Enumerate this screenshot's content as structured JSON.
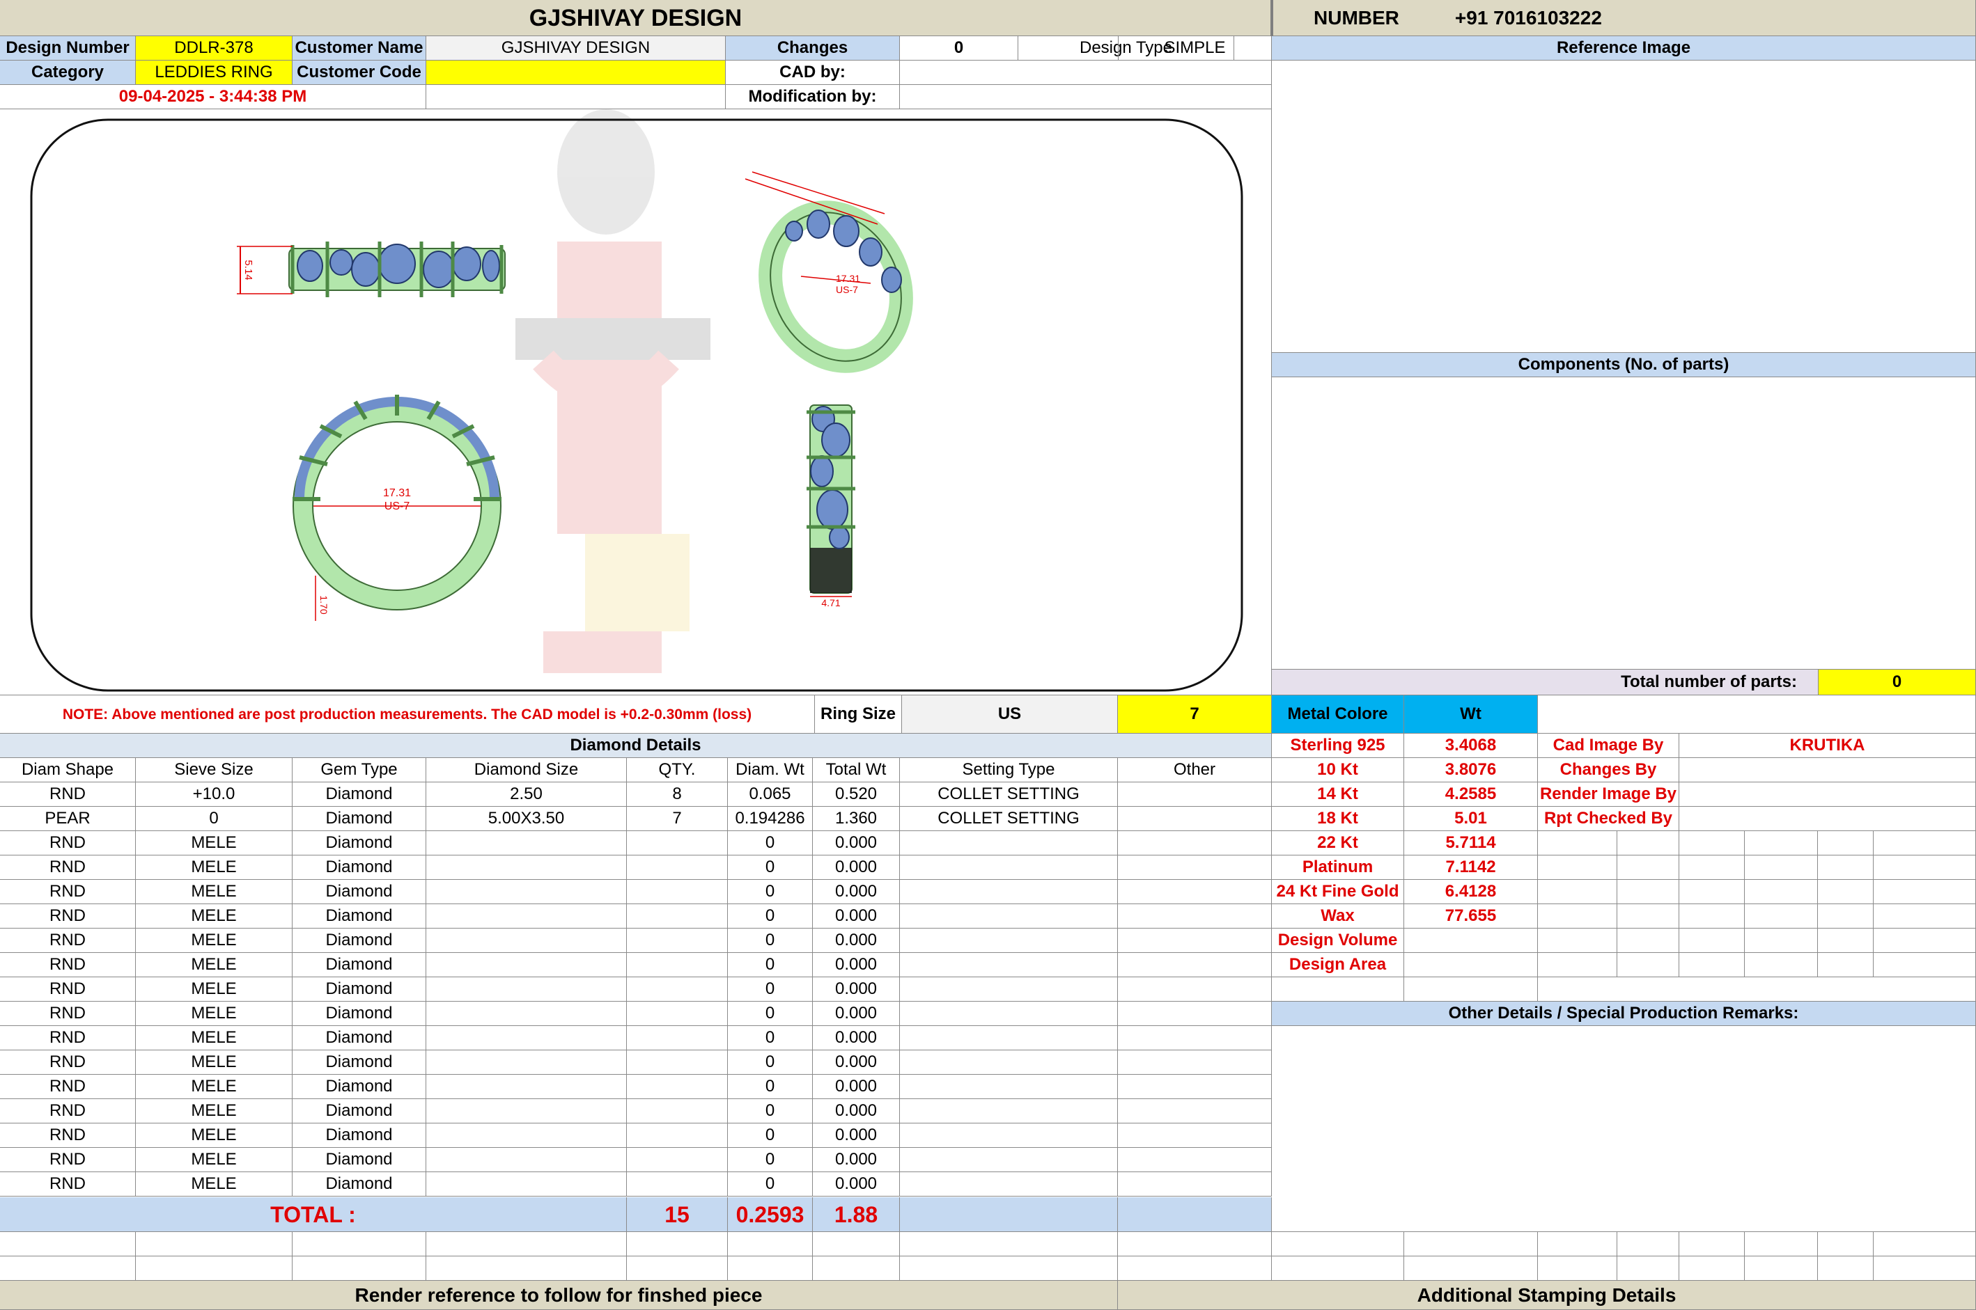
{
  "header": {
    "title": "GJSHIVAY DESIGN",
    "number_label": "NUMBER",
    "number_value": "+91 7016103222"
  },
  "info": {
    "design_number_label": "Design Number",
    "design_number": "DDLR-378",
    "customer_name_label": "Customer Name",
    "customer_name": "GJSHIVAY DESIGN",
    "changes_label": "Changes",
    "changes": "0",
    "design_type_label": "Design Type",
    "design_type": "SIMPLE",
    "category_label": "Category",
    "category": "LEDDIES RING",
    "customer_code_label": "Customer Code",
    "customer_code": "",
    "cad_by_label": "CAD by:",
    "cad_by": "",
    "datetime": "09-04-2025 - 3:44:38 PM",
    "modification_by_label": "Modification by:",
    "modification_by": ""
  },
  "drawing": {
    "front_height": "5.14",
    "perspective_inner": "17.31",
    "perspective_size": "US-7",
    "side_inner": "17.31",
    "side_size": "US-7",
    "side_thickness": "1.70",
    "top_width": "4.71"
  },
  "note": "NOTE: Above mentioned are post production measurements. The CAD model is +0.2-0.30mm (loss)",
  "ring_size": {
    "label": "Ring Size",
    "unit": "US",
    "value": "7"
  },
  "diamond_details": {
    "title": "Diamond Details",
    "headers": [
      "Diam Shape",
      "Sieve Size",
      "Gem Type",
      "Diamond Size",
      "QTY.",
      "Diam. Wt",
      "Total Wt",
      "Setting Type",
      "Other"
    ],
    "rows": [
      [
        "RND",
        "+10.0",
        "Diamond",
        "2.50",
        "8",
        "0.065",
        "0.520",
        "COLLET SETTING",
        ""
      ],
      [
        "PEAR",
        "0",
        "Diamond",
        "5.00X3.50",
        "7",
        "0.194286",
        "1.360",
        "COLLET SETTING",
        ""
      ],
      [
        "RND",
        "MELE",
        "Diamond",
        "",
        "",
        "0",
        "0.000",
        "",
        ""
      ],
      [
        "RND",
        "MELE",
        "Diamond",
        "",
        "",
        "0",
        "0.000",
        "",
        ""
      ],
      [
        "RND",
        "MELE",
        "Diamond",
        "",
        "",
        "0",
        "0.000",
        "",
        ""
      ],
      [
        "RND",
        "MELE",
        "Diamond",
        "",
        "",
        "0",
        "0.000",
        "",
        ""
      ],
      [
        "RND",
        "MELE",
        "Diamond",
        "",
        "",
        "0",
        "0.000",
        "",
        ""
      ],
      [
        "RND",
        "MELE",
        "Diamond",
        "",
        "",
        "0",
        "0.000",
        "",
        ""
      ],
      [
        "RND",
        "MELE",
        "Diamond",
        "",
        "",
        "0",
        "0.000",
        "",
        ""
      ],
      [
        "RND",
        "MELE",
        "Diamond",
        "",
        "",
        "0",
        "0.000",
        "",
        ""
      ],
      [
        "RND",
        "MELE",
        "Diamond",
        "",
        "",
        "0",
        "0.000",
        "",
        ""
      ],
      [
        "RND",
        "MELE",
        "Diamond",
        "",
        "",
        "0",
        "0.000",
        "",
        ""
      ],
      [
        "RND",
        "MELE",
        "Diamond",
        "",
        "",
        "0",
        "0.000",
        "",
        ""
      ],
      [
        "RND",
        "MELE",
        "Diamond",
        "",
        "",
        "0",
        "0.000",
        "",
        ""
      ],
      [
        "RND",
        "MELE",
        "Diamond",
        "",
        "",
        "0",
        "0.000",
        "",
        ""
      ],
      [
        "RND",
        "MELE",
        "Diamond",
        "",
        "",
        "0",
        "0.000",
        "",
        ""
      ],
      [
        "RND",
        "MELE",
        "Diamond",
        "",
        "",
        "0",
        "0.000",
        "",
        ""
      ]
    ],
    "total_label": "TOTAL :",
    "total_qty": "15",
    "total_diam_wt": "0.2593",
    "total_wt": "1.88"
  },
  "reference_image": {
    "title": "Reference Image"
  },
  "components": {
    "title": "Components (No. of parts)",
    "total_label": "Total number of parts:",
    "total_value": "0"
  },
  "metal": {
    "header_color": "Metal Colore",
    "header_wt": "Wt",
    "rows": [
      {
        "name": "Sterling 925",
        "wt": "3.4068"
      },
      {
        "name": "10 Kt",
        "wt": "3.8076"
      },
      {
        "name": "14 Kt",
        "wt": "4.2585"
      },
      {
        "name": "18 Kt",
        "wt": "5.01"
      },
      {
        "name": "22 Kt",
        "wt": "5.7114"
      },
      {
        "name": "Platinum",
        "wt": "7.1142"
      },
      {
        "name": "24 Kt Fine Gold",
        "wt": "6.4128"
      },
      {
        "name": "Wax",
        "wt": "77.655"
      },
      {
        "name": "Design Volume",
        "wt": ""
      },
      {
        "name": "Design Area",
        "wt": ""
      }
    ]
  },
  "credits": [
    {
      "label": "Cad Image By",
      "value": "KRUTIKA"
    },
    {
      "label": "Changes By",
      "value": ""
    },
    {
      "label": "Render Image By",
      "value": ""
    },
    {
      "label": "Rpt Checked By",
      "value": ""
    }
  ],
  "other_details": {
    "title": "Other Details / Special Production Remarks:"
  },
  "footer": {
    "render_reference": "Render reference to follow for finshed piece",
    "stamping": "Additional Stamping Details"
  },
  "colors": {
    "highlight": "#ffff00",
    "header_tan": "#ddd9c4",
    "header_blue": "#c5d9f1",
    "metal_header": "#00b0f0",
    "metal_text": "#e00000",
    "ring_metal": "#b2e6ab",
    "gem": "#6f8fcb"
  }
}
